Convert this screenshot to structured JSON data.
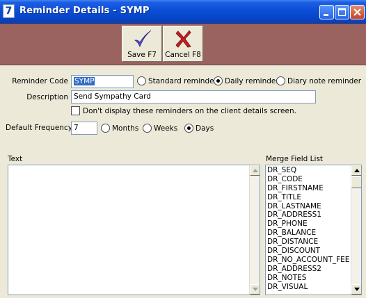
{
  "window": {
    "icon_glyph": "7",
    "title": "Reminder Details - SYMP",
    "controls": [
      "minimize-icon",
      "maximize-icon",
      "close-icon"
    ]
  },
  "toolbar": {
    "save_label": "Save F7",
    "save_icon": "checkmark-icon",
    "cancel_label": "Cancel F8",
    "cancel_icon": "x-icon"
  },
  "form": {
    "reminder_code_label": "Reminder Code",
    "reminder_code_value": "SYMP",
    "reminder_type_options": [
      {
        "label": "Standard reminder",
        "selected": false
      },
      {
        "label": "Daily reminder",
        "selected": true
      },
      {
        "label": "Diary note reminder",
        "selected": false
      }
    ],
    "description_label": "Description",
    "description_value": "Send Sympathy Card",
    "dont_display_label": "Don't display these reminders on the client details screen.",
    "dont_display_checked": false,
    "default_frequency_label": "Default Frequency",
    "default_frequency_value": "7",
    "frequency_unit_options": [
      {
        "label": "Months",
        "selected": false
      },
      {
        "label": "Weeks",
        "selected": false
      },
      {
        "label": "Days",
        "selected": true
      }
    ]
  },
  "text_section": {
    "label": "Text",
    "value": ""
  },
  "merge_fields": {
    "label": "Merge Field List",
    "items": [
      "DR_SEQ",
      "DR_CODE",
      "DR_FIRSTNAME",
      "DR_TITLE",
      "DR_LASTNAME",
      "DR_ADDRESS1",
      "DR_PHONE",
      "DR_BALANCE",
      "DR_DISTANCE",
      "DR_DISCOUNT",
      "DR_NO_ACCOUNT_FEE",
      "DR_ADDRESS2",
      "DR_NOTES",
      "DR_VISUAL"
    ]
  },
  "colors": {
    "titlebar": "#0a4fd6",
    "toolbar": "#9a6360",
    "dialog": "#ece9d8",
    "selection": "#316ac5",
    "save_icon": "#5a4fc8",
    "cancel_icon": "#c42020"
  }
}
